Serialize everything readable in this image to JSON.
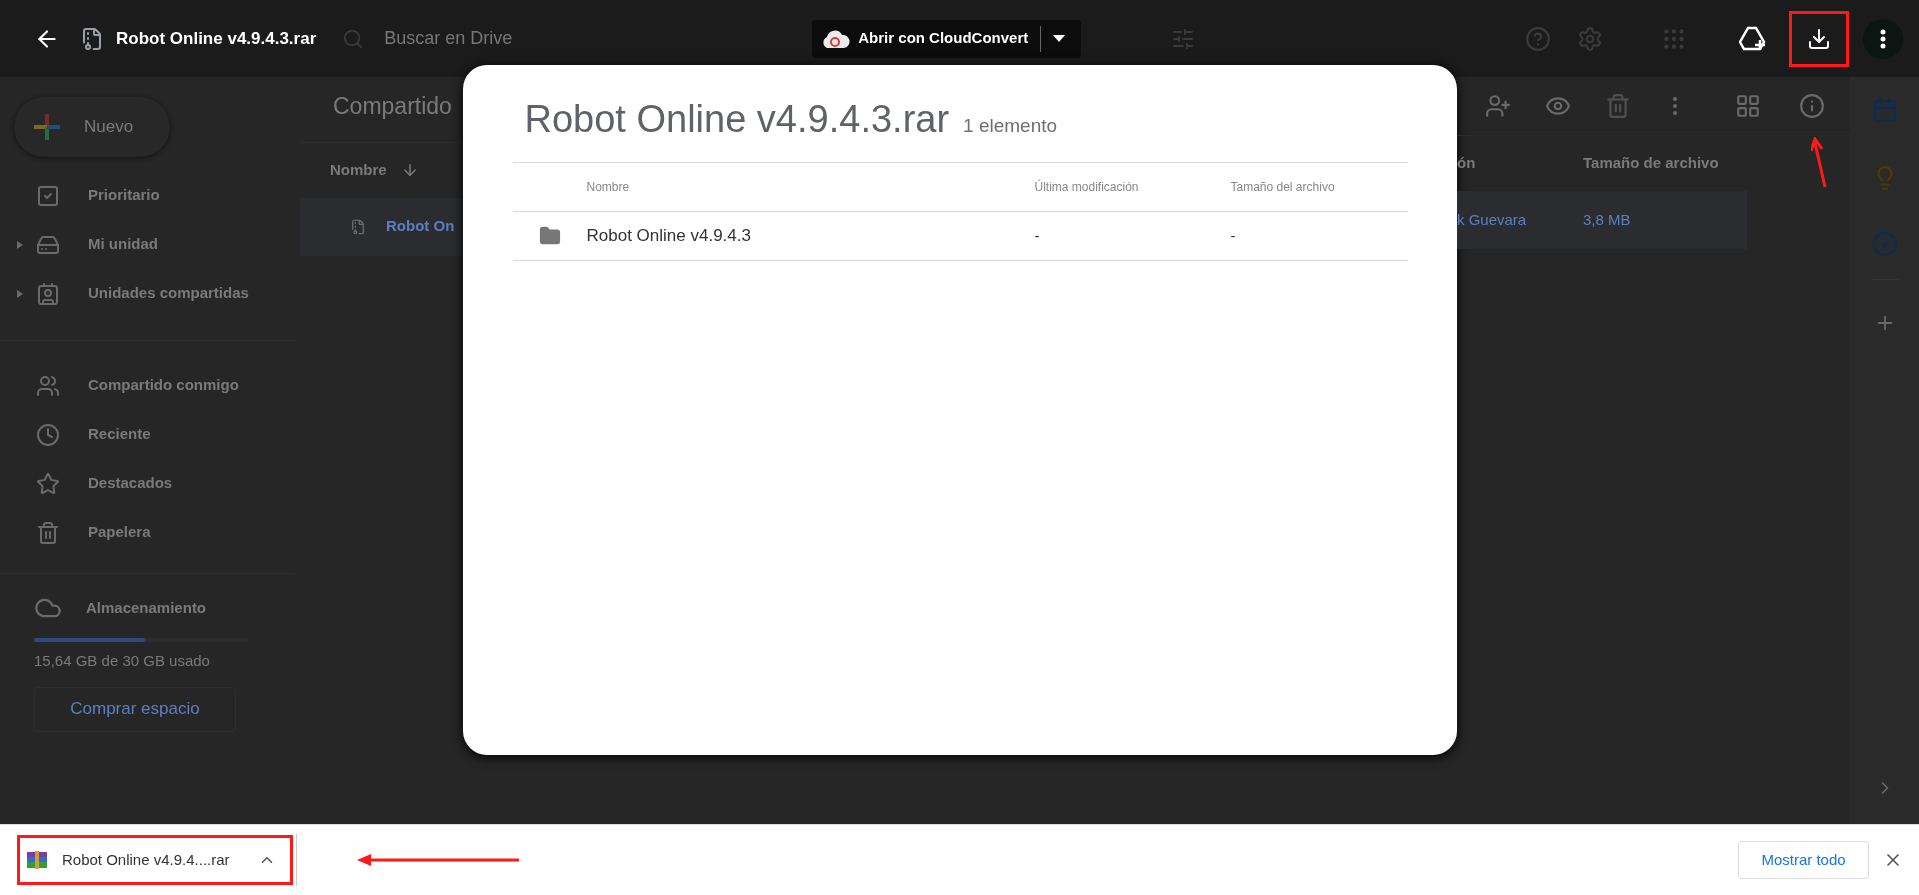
{
  "top_bar": {
    "file_title": "Robot Online v4.9.4.3.rar",
    "search": {
      "placeholder": "Buscar en Drive"
    },
    "open_with": "Abrir con CloudConvert"
  },
  "sidebar": {
    "new_button": "Nuevo",
    "groups": [
      [
        {
          "label": "Prioritario",
          "expandable": false
        },
        {
          "label": "Mi unidad",
          "expandable": true
        },
        {
          "label": "Unidades compartidas",
          "expandable": true
        }
      ],
      [
        {
          "label": "Compartido conmigo",
          "expandable": false
        },
        {
          "label": "Reciente",
          "expandable": false
        },
        {
          "label": "Destacados",
          "expandable": false
        },
        {
          "label": "Papelera",
          "expandable": false
        }
      ]
    ],
    "storage": {
      "label": "Almacenamiento",
      "level": 0.52,
      "usage": "15,64 GB de 30 GB usado",
      "button": "Comprar espacio"
    }
  },
  "main_left": {
    "heading": "Compartido",
    "column": "Nombre",
    "row_name": "Robot On"
  },
  "main_right": {
    "columns": [
      "ón",
      "Tamaño de archivo"
    ],
    "row": [
      "k Guevara",
      "3,8 MB"
    ]
  },
  "dialog": {
    "title": "Robot Online v4.9.4.3.rar",
    "count": "1 elemento",
    "columns": [
      "Nombre",
      "Última modificación",
      "Tamaño del archivo"
    ],
    "rows": [
      {
        "name": "Robot Online v4.9.4.3",
        "modified": "-",
        "size": "-"
      }
    ]
  },
  "download_bar": {
    "items": [
      {
        "filename": "Robot Online v4.9.4....rar"
      }
    ],
    "show_all": "Mostrar todo"
  }
}
